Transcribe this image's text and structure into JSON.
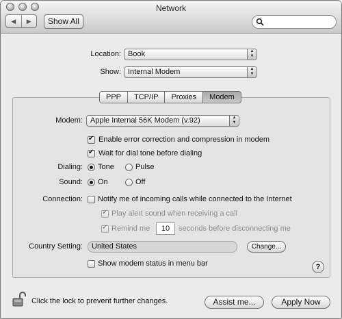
{
  "window": {
    "title": "Network"
  },
  "toolbar": {
    "back_glyph": "◀",
    "forward_glyph": "▶",
    "show_all_label": "Show All",
    "search_value": ""
  },
  "location": {
    "label": "Location:",
    "value": "Book"
  },
  "show": {
    "label": "Show:",
    "value": "Internal Modem"
  },
  "tabs": [
    {
      "label": "PPP",
      "active": false
    },
    {
      "label": "TCP/IP",
      "active": false
    },
    {
      "label": "Proxies",
      "active": false
    },
    {
      "label": "Modem",
      "active": true
    }
  ],
  "modem": {
    "label": "Modem:",
    "value": "Apple Internal 56K Modem (v.92)",
    "error_correction": {
      "label": "Enable error correction and compression in modem",
      "checked": true
    },
    "wait_dial_tone": {
      "label": "Wait for dial tone before dialing",
      "checked": true
    }
  },
  "dialing": {
    "label": "Dialing:",
    "options": [
      {
        "label": "Tone",
        "selected": true
      },
      {
        "label": "Pulse",
        "selected": false
      }
    ]
  },
  "sound": {
    "label": "Sound:",
    "options": [
      {
        "label": "On",
        "selected": true
      },
      {
        "label": "Off",
        "selected": false
      }
    ]
  },
  "connection": {
    "label": "Connection:",
    "notify": {
      "label": "Notify me of incoming calls while connected to the Internet",
      "checked": false
    },
    "play_alert": {
      "label": "Play alert sound when receiving a call",
      "checked": true,
      "enabled": false
    },
    "remind": {
      "label_before": "Remind me",
      "seconds": "10",
      "label_after": "seconds before disconnecting me",
      "checked": true,
      "enabled": false
    }
  },
  "country": {
    "label": "Country Setting:",
    "value": "United States",
    "change_label": "Change..."
  },
  "status_menu": {
    "label": "Show modem status in menu bar",
    "checked": false
  },
  "help": {
    "label": "?"
  },
  "footer": {
    "lock_text": "Click the lock to prevent further changes.",
    "assist_label": "Assist me...",
    "apply_label": "Apply Now"
  }
}
